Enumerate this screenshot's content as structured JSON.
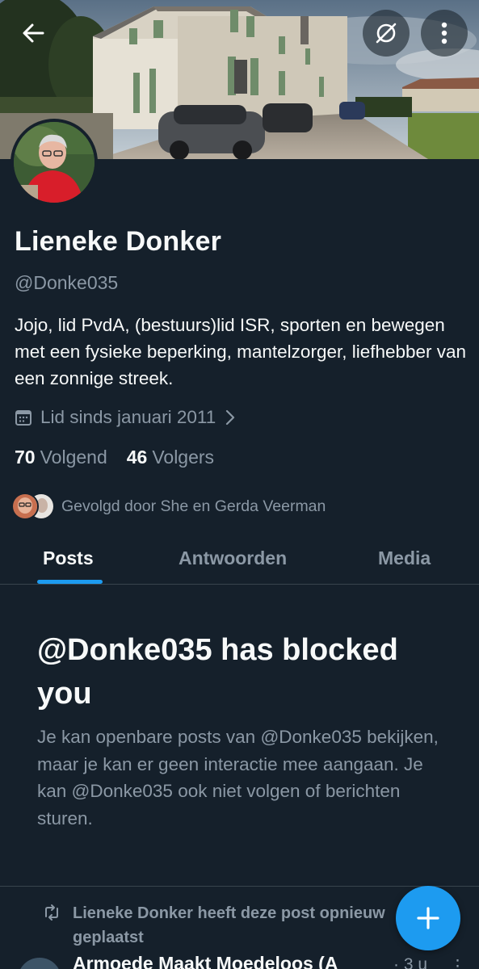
{
  "profile": {
    "name": "Lieneke Donker",
    "handle": "@Donke035",
    "bio": "Jojo, lid PvdA, (bestuurs)lid ISR, sporten en bewegen met een fysieke beperking, mantelzorger, liefhebber van een zonnige streek.",
    "joined": "Lid sinds januari 2011",
    "following_count": "70",
    "following_label": "Volgend",
    "followers_count": "46",
    "followers_label": "Volgers",
    "followed_by": "Gevolgd door She en Gerda Veerman"
  },
  "tabs": [
    {
      "label": "Posts",
      "active": true
    },
    {
      "label": "Antwoorden",
      "active": false
    },
    {
      "label": "Media",
      "active": false
    }
  ],
  "blocked": {
    "title": "@Donke035 has blocked you",
    "message": "Je kan openbare posts van @Donke035 bekijken, maar je kan er geen interactie mee aangaan. Je kan @Donke035 ook niet volgen of berichten sturen."
  },
  "feed": {
    "repost_text": "Lieneke Donker heeft deze post opnieuw geplaatst",
    "author": "Armoede Maakt Moedeloos (A",
    "time": "· 3 u",
    "more": "⋮"
  },
  "icons": {
    "back": "arrow-left-icon",
    "unfollow": "unfollow-icon",
    "more": "more-vertical-icon",
    "calendar": "calendar-icon",
    "chevron": "chevron-right-icon",
    "retweet": "retweet-icon",
    "compose": "plus-icon"
  },
  "colors": {
    "background": "#15202b",
    "accent": "#1d9bf0",
    "text_primary": "#f7f9f9",
    "text_secondary": "#8b98a5",
    "divider": "#38444d"
  }
}
